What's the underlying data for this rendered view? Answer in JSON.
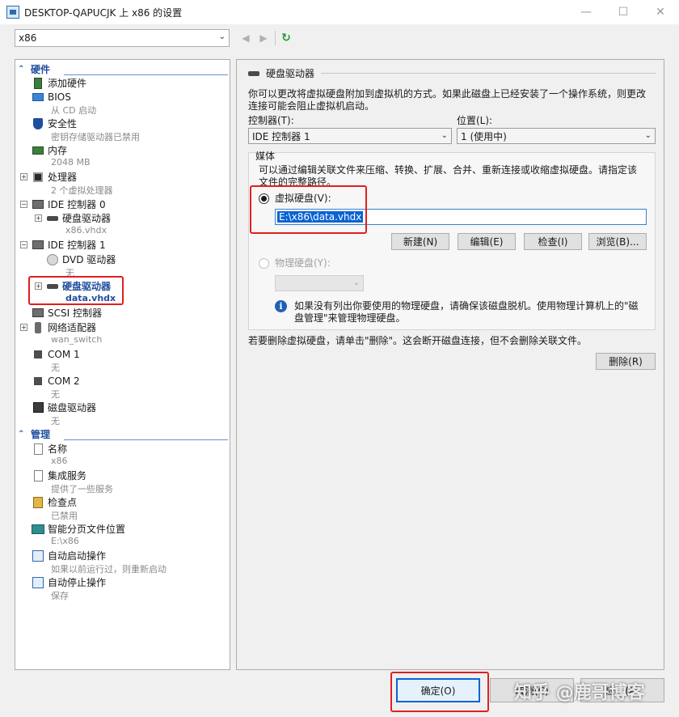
{
  "window": {
    "title": "DESKTOP-QAPUCJK 上 x86 的设置",
    "minimize_glyph": "—",
    "maximize_glyph": "☐",
    "close_glyph": "✕"
  },
  "vm_selector": {
    "value": "x86"
  },
  "nav": {
    "back_glyph": "◀",
    "forward_glyph": "▶",
    "refresh_glyph": "↻"
  },
  "tree": {
    "hardware_header": "硬件",
    "management_header": "管理",
    "section_toggle": "⌃",
    "add_hardware": "添加硬件",
    "bios": {
      "label": "BIOS",
      "detail": "从 CD 启动"
    },
    "security": {
      "label": "安全性",
      "detail": "密钥存储驱动器已禁用"
    },
    "memory": {
      "label": "内存",
      "detail": "2048 MB"
    },
    "processor": {
      "label": "处理器",
      "detail": "2 个虚拟处理器"
    },
    "ide0": {
      "label": "IDE 控制器 0"
    },
    "ide0_hdd": {
      "label": "硬盘驱动器",
      "detail": "x86.vhdx"
    },
    "ide1": {
      "label": "IDE 控制器 1"
    },
    "dvd": {
      "label": "DVD 驱动器",
      "detail": "无"
    },
    "ide1_hdd": {
      "label": "硬盘驱动器",
      "detail": "data.vhdx"
    },
    "scsi": {
      "label": "SCSI 控制器"
    },
    "network": {
      "label": "网络适配器",
      "detail": "wan_switch"
    },
    "com1": {
      "label": "COM 1",
      "detail": "无"
    },
    "com2": {
      "label": "COM 2",
      "detail": "无"
    },
    "floppy": {
      "label": "磁盘驱动器",
      "detail": "无"
    },
    "name": {
      "label": "名称",
      "detail": "x86"
    },
    "integration": {
      "label": "集成服务",
      "detail": "提供了一些服务"
    },
    "checkpoint": {
      "label": "检查点",
      "detail": "已禁用"
    },
    "paging": {
      "label": "智能分页文件位置",
      "detail": "E:\\x86"
    },
    "autostart": {
      "label": "自动启动操作",
      "detail": "如果以前运行过，则重新启动"
    },
    "autostop": {
      "label": "自动停止操作",
      "detail": "保存"
    }
  },
  "panel": {
    "title": "硬盘驱动器",
    "intro_line1": "你可以更改将虚拟硬盘附加到虚拟机的方式。如果此磁盘上已经安装了一个操作系统，则更改",
    "intro_line2": "连接可能会阻止虚拟机启动。",
    "controller_label": "控制器(T):",
    "controller_value": "IDE 控制器 1",
    "location_label": "位置(L):",
    "location_value": "1 (使用中)",
    "media_label": "媒体",
    "media_desc_line1": "可以通过编辑关联文件来压缩、转换、扩展、合并、重新连接或收缩虚拟硬盘。请指定该",
    "media_desc_line2": "文件的完整路径。",
    "vhd_radio": "虚拟硬盘(V):",
    "vhd_path": "E:\\x86\\data.vhdx",
    "btn_new": "新建(N)",
    "btn_edit": "编辑(E)",
    "btn_inspect": "检查(I)",
    "btn_browse": "浏览(B)...",
    "phys_radio": "物理硬盘(Y):",
    "info_line1": "如果没有列出你要使用的物理硬盘，请确保该磁盘脱机。使用物理计算机上的\"磁",
    "info_line2": "盘管理\"来管理物理硬盘。",
    "remove_text": "若要删除虚拟硬盘，请单击\"删除\"。这会断开磁盘连接，但不会删除关联文件。",
    "btn_remove": "删除(R)",
    "chevron_glyph": "⌄",
    "info_glyph": "i"
  },
  "footer": {
    "ok": "确定(O)",
    "cancel": "取消(C)",
    "apply": "应用(A)",
    "watermark": "知乎 @鹿哥博客"
  },
  "annotation_color": "#e02020"
}
